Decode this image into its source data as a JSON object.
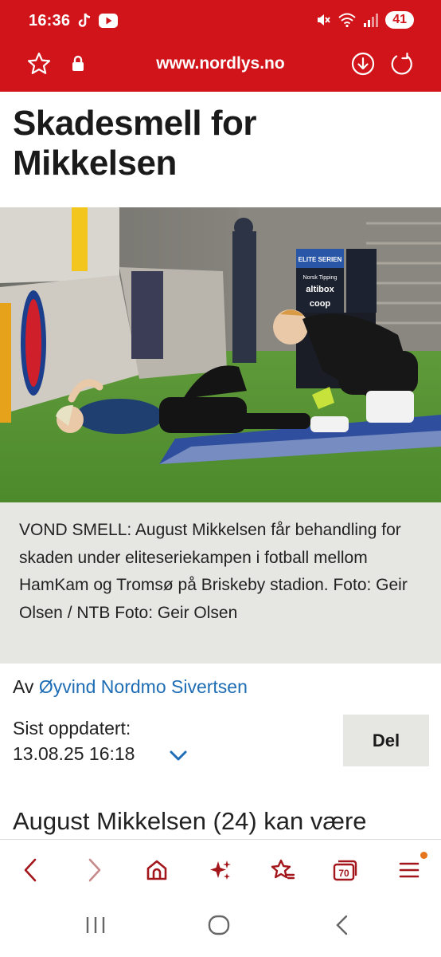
{
  "status_bar": {
    "time": "16:36",
    "battery": "41",
    "icons": [
      "tiktok-icon",
      "youtube-icon",
      "mute-icon",
      "wifi-icon",
      "signal-icon"
    ]
  },
  "browser": {
    "url": "www.nordlys.no",
    "theme_color": "#d1141a"
  },
  "article": {
    "headline": "Skadesmell for Mikkelsen",
    "caption": "VOND SMELL: August Mikkelsen får behandling for skaden under eliteseriekampen i fotball mellom HamKam og Tromsø på Briskeby stadion. Foto: Geir Olsen / NTB Foto: Geir Olsen",
    "byline_prefix": "Av",
    "author": "Øyvind Nordmo Sivertsen",
    "updated_label": "Sist oppdatert:",
    "updated_date": "13.08.25 16:18",
    "share_label": "Del",
    "lead_text": "August Mikkelsen (24) kan være",
    "photo_signage": {
      "board_top": "ELITE SERIEN",
      "board_brand_1": "Norsk Tipping",
      "board_brand_2": "altibox",
      "board_brand_3": "coop"
    }
  },
  "bottom_nav": {
    "tabs_count": "70",
    "accent_color": "#a3161b",
    "notification_color": "#e7751b"
  }
}
